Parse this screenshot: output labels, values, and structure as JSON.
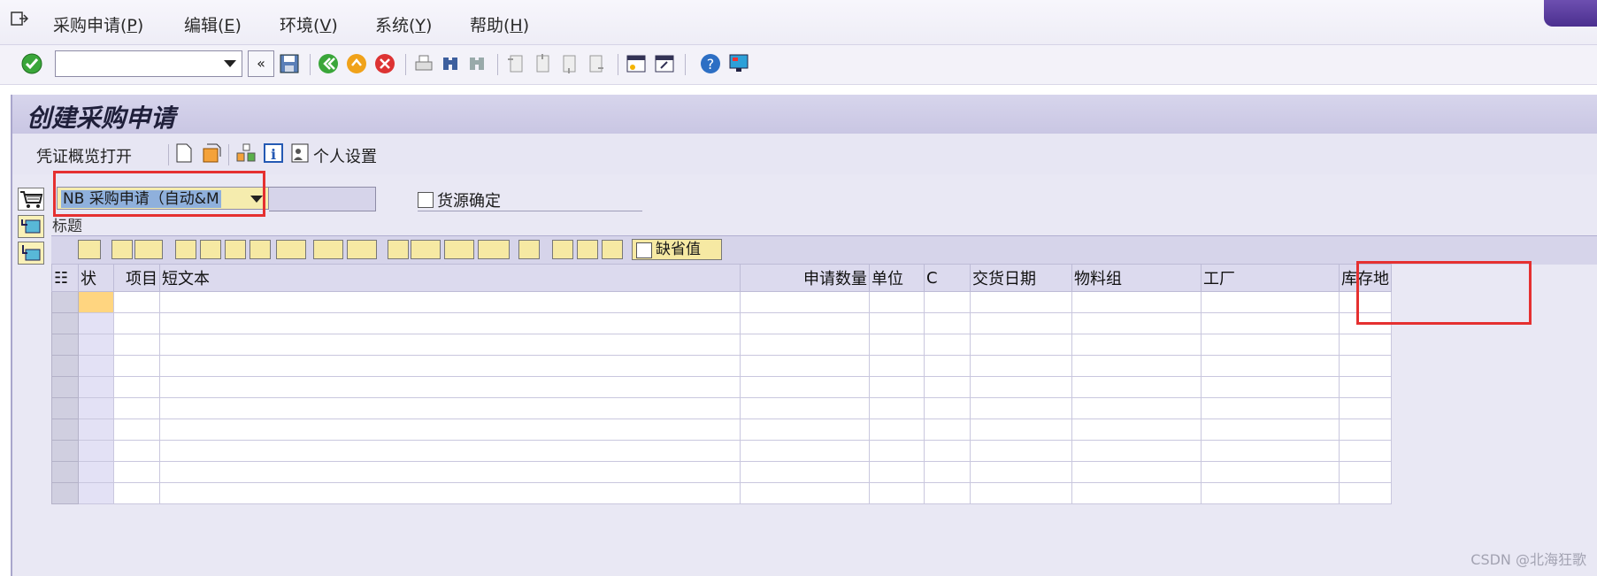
{
  "menubar": {
    "items": [
      {
        "label": "采购申请(",
        "key": "P",
        "end": ")"
      },
      {
        "label": "编辑(",
        "key": "E",
        "end": ")"
      },
      {
        "label": "环境(",
        "key": "V",
        "end": ")"
      },
      {
        "label": "系统(",
        "key": "Y",
        "end": ")"
      },
      {
        "label": "帮助(",
        "key": "H",
        "end": ")"
      }
    ]
  },
  "stdbar": {
    "command_value": "",
    "back_glyph": "«"
  },
  "title": "创建采购申请",
  "appbar": {
    "doc_overview": "凭证概览打开",
    "personal_settings": "个人设置"
  },
  "header": {
    "doc_type": "NB 采购申请（自动&M",
    "source_determination": "货源确定",
    "header_label": "标题"
  },
  "alv": {
    "default_values": "缺省值"
  },
  "grid": {
    "columns": [
      "状",
      "项目",
      "短文本",
      "申请数量",
      "单位",
      "C",
      "交货日期",
      "物料组",
      "工厂",
      "库存地"
    ]
  },
  "colors": {
    "title_bg": "#c9c6e3",
    "highlight_box": "#e53030",
    "selected_cell": "#ffd580"
  },
  "watermark": "CSDN @北海狂歌"
}
